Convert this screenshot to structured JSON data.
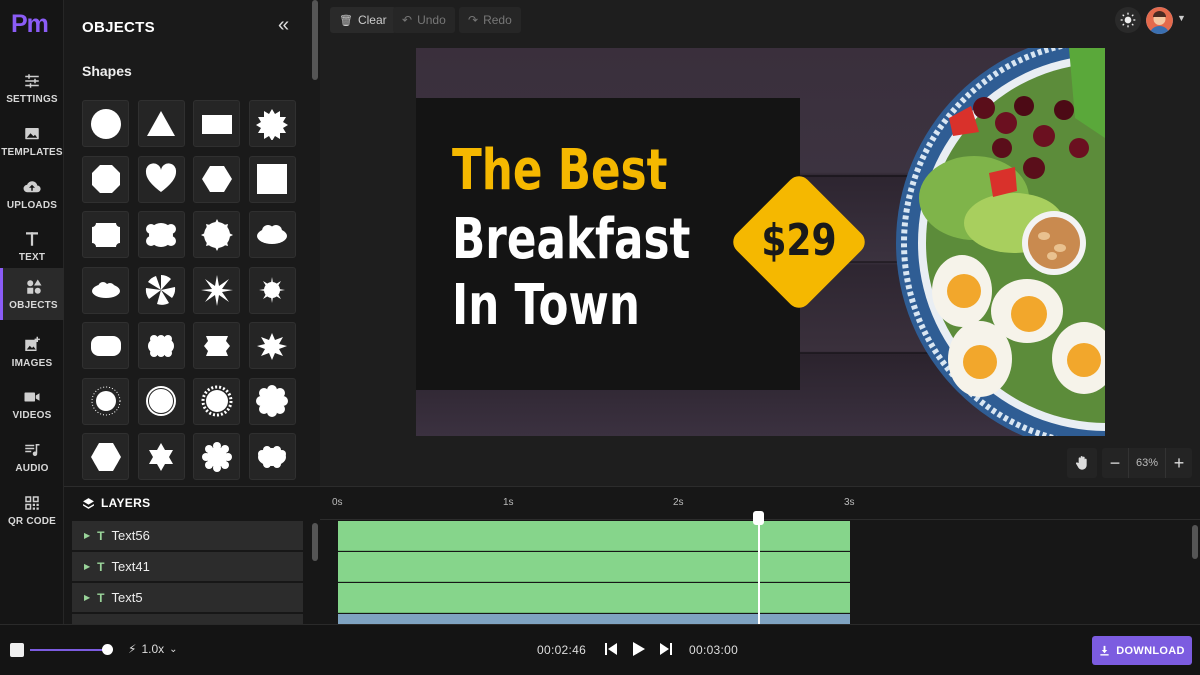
{
  "app": {
    "logo": "Pm",
    "accent": "#8b5cf6"
  },
  "rail": {
    "items": [
      {
        "label": "SETTINGS",
        "icon": "sliders-icon"
      },
      {
        "label": "TEMPLATES",
        "icon": "images-icon"
      },
      {
        "label": "UPLOADS",
        "icon": "cloud-upload-icon"
      },
      {
        "label": "TEXT",
        "icon": "text-icon"
      },
      {
        "label": "OBJECTS",
        "icon": "shapes-icon",
        "active": true
      },
      {
        "label": "IMAGES",
        "icon": "add-image-icon"
      },
      {
        "label": "VIDEOS",
        "icon": "video-camera-icon"
      },
      {
        "label": "AUDIO",
        "icon": "music-list-icon"
      },
      {
        "label": "QR CODE",
        "icon": "qr-code-icon"
      }
    ]
  },
  "panel": {
    "title": "OBJECTS",
    "collapse": "«",
    "section": "Shapes",
    "shapes": [
      "circle",
      "triangle",
      "rectangle",
      "starburst",
      "octagon-wavy",
      "heart",
      "hexagon",
      "square",
      "badge-notched",
      "badge-rounded",
      "burst-20",
      "cloud",
      "cloud-small",
      "swirl",
      "spiky-star",
      "sunburst",
      "pill-wavy",
      "pill-scalloped",
      "ornate-frame",
      "star-burst-12",
      "sunburst-fine",
      "circle-wavy",
      "burst-24",
      "scalloped-octagon",
      "wavy-hexagon",
      "star-six",
      "flower",
      "flower-oval"
    ]
  },
  "toolbar": {
    "clear": "Clear",
    "undo": "Undo",
    "redo": "Redo"
  },
  "canvas": {
    "line1": "The Best",
    "line2": "Breakfast",
    "line3": "In Town",
    "price": "$29",
    "colors": {
      "yellow": "#f5b800",
      "card": "#141414"
    }
  },
  "zoom": {
    "minus": "−",
    "value": "63%",
    "plus": "+"
  },
  "layers": {
    "title": "LAYERS",
    "items": [
      "Text56",
      "Text41",
      "Text5"
    ]
  },
  "timeline": {
    "ticks": [
      "0s",
      "1s",
      "2s",
      "3s"
    ]
  },
  "transport": {
    "speed": "1.0x",
    "current_time": "00:02:46",
    "total_time": "00:03:00",
    "download": "DOWNLOAD"
  }
}
